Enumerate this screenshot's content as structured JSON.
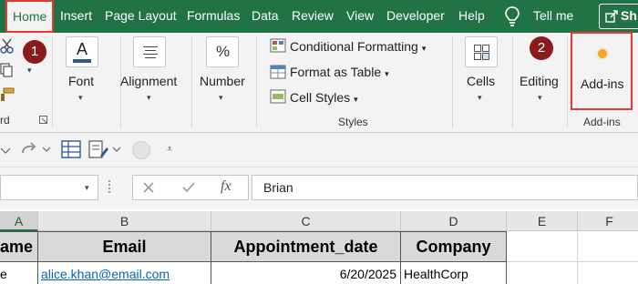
{
  "menu": {
    "tabs": [
      "Home",
      "Insert",
      "Page Layout",
      "Formulas",
      "Data",
      "Review",
      "View",
      "Developer",
      "Help"
    ],
    "tell_me": "Tell me",
    "share": "Sh"
  },
  "ribbon": {
    "clipboard_label": "rd",
    "font_label": "Font",
    "alignment_label": "Alignment",
    "number_label": "Number",
    "number_icon": "%",
    "conditional_formatting": "Conditional Formatting",
    "format_as_table": "Format as Table",
    "cell_styles": "Cell Styles",
    "styles_group": "Styles",
    "cells_label": "Cells",
    "editing_label": "Editing",
    "addins_label": "Add-ins",
    "addins_group": "Add-ins",
    "callout_1": "1",
    "callout_2": "2"
  },
  "formula_bar": {
    "fx": "fx",
    "value": "Brian"
  },
  "grid": {
    "columns": [
      "A",
      "B",
      "C",
      "D",
      "E",
      "F"
    ],
    "header_row": [
      "ame",
      "Email",
      "Appointment_date",
      "Company"
    ],
    "row1": [
      "e",
      "alice.khan@email.com",
      "6/20/2025",
      "HealthCorp"
    ]
  },
  "colors": {
    "excel_green": "#217346",
    "highlight_red": "#e53935",
    "callout_red": "#8b1a1a",
    "link_blue": "#0563c1"
  }
}
